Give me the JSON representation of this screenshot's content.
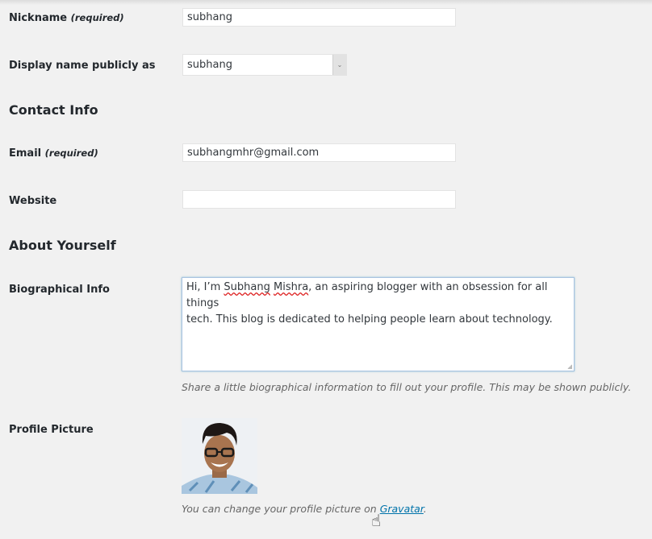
{
  "nickname": {
    "label": "Nickname",
    "required": "(required)",
    "value": "subhang"
  },
  "display_name": {
    "label": "Display name publicly as",
    "selected": "subhang"
  },
  "contact_info": {
    "heading": "Contact Info",
    "email": {
      "label": "Email",
      "required": "(required)",
      "value": "subhangmhr@gmail.com"
    },
    "website": {
      "label": "Website",
      "value": ""
    }
  },
  "about": {
    "heading": "About Yourself",
    "bio": {
      "label": "Biographical Info",
      "text_prefix": "Hi, I’m ",
      "misspelled_1": "Subhang",
      "misspelled_2": "Mishra",
      "text_line1_rest": ", an aspiring blogger with an obsession for all things",
      "text_line2": "tech. This blog is dedicated to helping people learn about technology.",
      "description": "Share a little biographical information to fill out your profile. This may be shown publicly."
    },
    "profile_picture": {
      "label": "Profile Picture",
      "description_prefix": "You can change your profile picture on ",
      "link_text": "Gravatar",
      "description_suffix": "."
    }
  },
  "colors": {
    "background": "#f1f1f1",
    "link": "#0073aa",
    "focus_border": "#a9c3e0"
  }
}
